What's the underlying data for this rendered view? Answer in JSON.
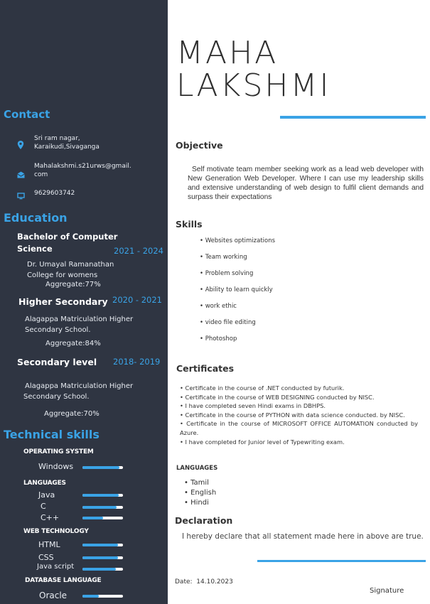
{
  "name": {
    "first": "MAHA",
    "last": "LAKSHMI"
  },
  "contact": {
    "title": "Contact",
    "address_line1": "Sri ram nagar,",
    "address_line2": "Karaikudi,Sivaganga",
    "email_line1": "Mahalakshmi.s21urws@gmail.",
    "email_line2": "com",
    "phone": "9629603742",
    "icons": [
      "map-pin-icon",
      "mail-icon",
      "monitor-icon"
    ]
  },
  "education": {
    "title": "Education",
    "entries": [
      {
        "degree_line1": "Bachelor of Computer",
        "degree_line2": "Science",
        "years": "2021 - 2024",
        "school_line1": "Dr. Umayal Ramanathan",
        "school_line2": "College  for womens",
        "aggregate": "Aggregate:77%"
      },
      {
        "degree_line1": "Higher Secondary",
        "years": "2020 - 2021",
        "school_line1": "Alagappa Matriculation Higher",
        "school_line2": "Secondary School.",
        "aggregate": "Aggregate:84%"
      },
      {
        "degree_line1": "Secondary level",
        "years": "2018- 2019",
        "school_line1": "Alagappa Matriculation Higher",
        "school_line2": "Secondary School.",
        "aggregate": "Aggregate:70%"
      }
    ]
  },
  "technical_skills": {
    "title": "Technical skills",
    "categories": [
      {
        "name": "OPERATING SYSTEM",
        "items": [
          {
            "label": "Windows",
            "level": 0.92
          }
        ]
      },
      {
        "name": "LANGUAGES",
        "items": [
          {
            "label": "Java",
            "level": 0.9
          },
          {
            "label": "C",
            "level": 0.85
          },
          {
            "label": "C++",
            "level": 0.5
          }
        ]
      },
      {
        "name": "WEB TECHNOLOGY",
        "items": [
          {
            "label": "HTML",
            "level": 0.88
          },
          {
            "label": "CSS",
            "level": 0.88
          },
          {
            "label": "Java script",
            "level": 0.82
          }
        ]
      },
      {
        "name": "DATABASE LANGUAGE",
        "items": [
          {
            "label": "Oracle",
            "level": 0.4
          }
        ]
      }
    ]
  },
  "objective": {
    "title": "Objective",
    "text": "Self motivate team member seeking work as a lead web developer with New Generation Web Developer. Where I can use my leadership skills and extensive understanding of web design to fulfil client demands and surpass their expectations"
  },
  "skills": {
    "title": "Skills",
    "items": [
      "Websites optimizations",
      "Team working",
      "Problem solving",
      "Ability to learn quickly",
      "work ethic",
      "video file editing",
      "Photoshop"
    ]
  },
  "certificates": {
    "title": "Certificates",
    "items": [
      "Certificate in the course of .NET conducted by futurik.",
      "Certificate in the course of WEB DESIGNING conducted by NISC.",
      "I have completed seven Hindi exams in DBHPS.",
      "Certificate in the course of PYTHON with data science conducted. by NISC.",
      "Certificate in the course of MICROSOFT OFFICE AUTOMATION conducted by Azure.",
      "I have completed for Junior level of Typewriting exam."
    ]
  },
  "languages": {
    "title": "LANGUAGES",
    "items": [
      "Tamil",
      "English",
      "Hindi"
    ]
  },
  "declaration": {
    "title": "Declaration",
    "text": "I hereby declare that all statement made here in above are true."
  },
  "footer": {
    "date_label": "Date:",
    "date_value": "14.10.2023",
    "signature": "Signature"
  },
  "colors": {
    "sidebar_bg": "#2f3542",
    "accent": "#3aa3e6"
  }
}
